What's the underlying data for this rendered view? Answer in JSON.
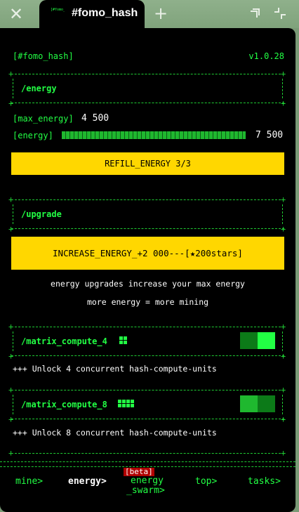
{
  "browser": {
    "tab_title": "#fomo_hash",
    "favicon_text": "[#fomo_hash]"
  },
  "header": {
    "app_name": "[#fomo_hash]",
    "version": "v1.0.28"
  },
  "energy_section": {
    "title": "/energy",
    "max_energy_label": "[max_energy]",
    "max_energy_value": "4 500",
    "energy_label": "[energy]",
    "energy_value": "7 500",
    "energy_fill_fraction": 1.0,
    "refill_button": "REFILL_ENERGY 3/3"
  },
  "upgrade_section": {
    "title": "/upgrade",
    "increase_button": "INCREASE_ENERGY_+2 000---[★200stars]",
    "info_line_1": "energy upgrades increase your max energy",
    "info_line_2": "more energy = more mining"
  },
  "features": [
    {
      "title": "/matrix_compute_4",
      "icon": "grid-2x2-icon",
      "enabled": true,
      "description": "+++ Unlock 4 concurrent hash-compute-units"
    },
    {
      "title": "/matrix_compute_8",
      "icon": "grid-4x2-icon",
      "enabled": false,
      "description": "+++ Unlock 8 concurrent hash-compute-units"
    }
  ],
  "nav": {
    "mine": "mine>",
    "energy": "energy>",
    "beta_badge": "[beta]",
    "energy_swarm_line1": "energy",
    "energy_swarm_line2": "_swarm>",
    "top": "top>",
    "tasks": "tasks>"
  },
  "colors": {
    "accent_green": "#22ff44",
    "button_yellow": "#ffd700",
    "background": "#000000",
    "beta_red": "#b00000"
  }
}
